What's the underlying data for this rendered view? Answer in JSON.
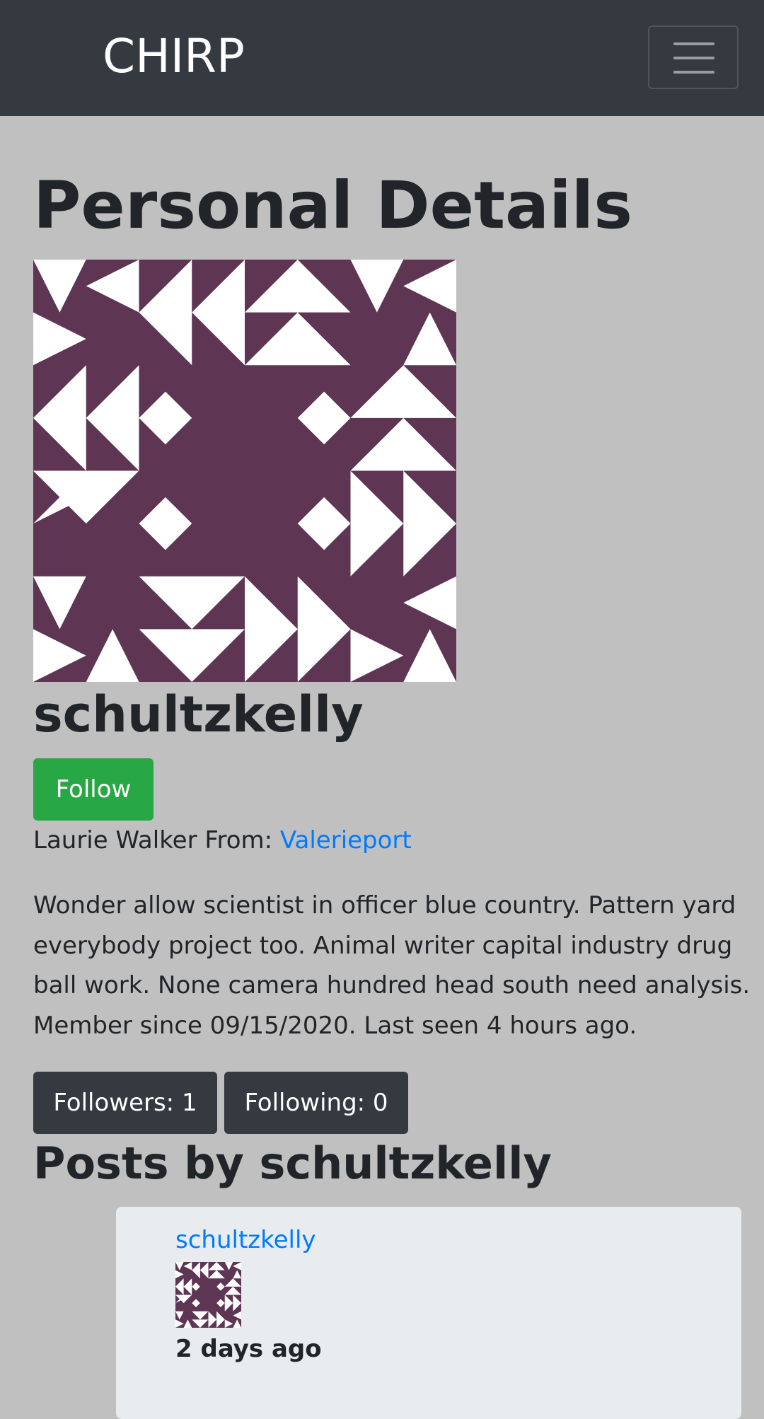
{
  "navbar": {
    "brand": "CHIRP",
    "toggle_icon": "hamburger-menu-icon"
  },
  "profile": {
    "heading": "Personal Details",
    "avatar_icon": "identicon-avatar",
    "avatar_colors": {
      "background": "#5e3553",
      "pattern": "#ffffff"
    },
    "username": "schultzkelly",
    "follow_label": "Follow",
    "full_name": "Laurie Walker",
    "from_label": " From: ",
    "location": "Valerieport",
    "bio": "Wonder allow scientist in officer blue country. Pattern yard everybody project too. Animal writer capital industry drug ball work. None camera hundred head south need analysis.",
    "member_since": "Member since 09/15/2020.",
    "last_seen": "Last seen 4 hours ago.",
    "followers_label": "Followers: 1",
    "following_label": "Following: 0"
  },
  "posts": {
    "heading": "Posts by schultzkelly",
    "items": [
      {
        "author": "schultzkelly",
        "time": "2 days ago"
      }
    ]
  },
  "colors": {
    "page_background": "#c0c0c0",
    "navbar": "#343a40",
    "follow_button": "#28a745",
    "link": "#007bff",
    "card": "#e9ecef"
  }
}
